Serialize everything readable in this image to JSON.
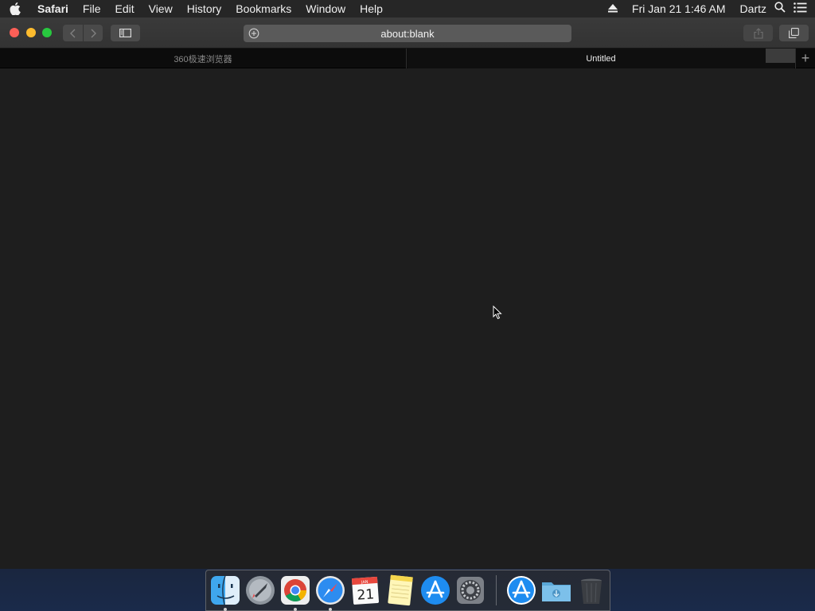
{
  "menubar": {
    "apple_icon": "apple-logo-icon",
    "app_name": "Safari",
    "items": [
      "File",
      "Edit",
      "View",
      "History",
      "Bookmarks",
      "Window",
      "Help"
    ],
    "clock": "Fri Jan 21  1:46 AM",
    "user": "Dartz"
  },
  "toolbar": {
    "address": "about:blank"
  },
  "tabs": [
    {
      "title": "360极速浏览器",
      "active": false
    },
    {
      "title": "Untitled",
      "active": true
    }
  ],
  "newtab_label": "+",
  "dock": {
    "items": [
      {
        "name": "Finder",
        "running": true
      },
      {
        "name": "Launchpad",
        "running": false
      },
      {
        "name": "Google Chrome",
        "running": true
      },
      {
        "name": "Safari",
        "running": true
      },
      {
        "name": "Calendar",
        "running": false,
        "month": "JAN",
        "day": "21"
      },
      {
        "name": "Notes",
        "running": false
      },
      {
        "name": "App Store",
        "running": false
      },
      {
        "name": "System Preferences",
        "running": false
      },
      {
        "name": "App Store Downloads",
        "running": false
      },
      {
        "name": "Downloads",
        "running": false
      },
      {
        "name": "Trash",
        "running": false
      }
    ]
  }
}
